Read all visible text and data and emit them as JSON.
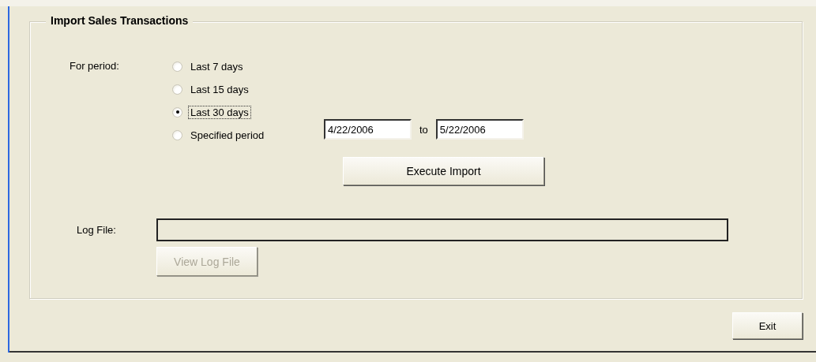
{
  "group": {
    "title": "Import Sales Transactions"
  },
  "period": {
    "label": "For period:",
    "options": [
      {
        "label": "Last 7 days",
        "selected": false
      },
      {
        "label": "Last 15 days",
        "selected": false
      },
      {
        "label": "Last 30 days",
        "selected": true
      },
      {
        "label": "Specified period",
        "selected": false
      }
    ],
    "from": "4/22/2006",
    "to_label": "to",
    "to": "5/22/2006"
  },
  "execute_button": {
    "label": "Execute Import",
    "disabled": false
  },
  "log_file": {
    "label": "Log File:"
  },
  "view_log_button": {
    "label": "View Log File",
    "disabled": true
  },
  "exit_button": {
    "label": "Exit",
    "disabled": false
  }
}
